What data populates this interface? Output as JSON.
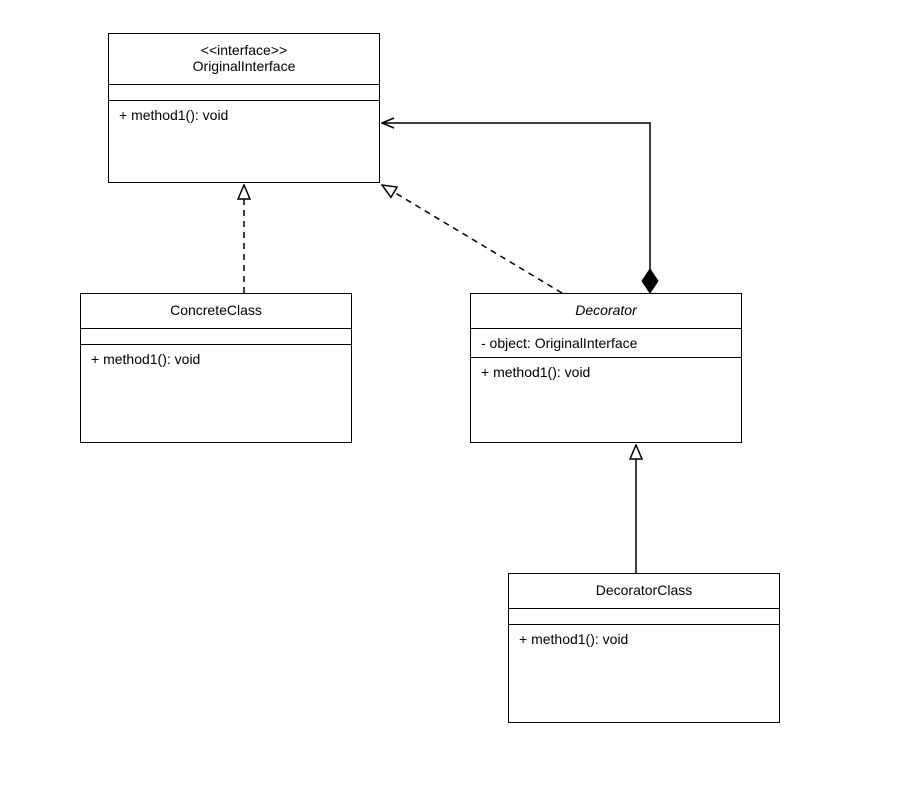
{
  "classes": {
    "originalInterface": {
      "stereotype": "<<interface>>",
      "name": "OriginalInterface",
      "attrs": "",
      "ops": "+ method1(): void"
    },
    "concreteClass": {
      "name": "ConcreteClass",
      "attrs": "",
      "ops": "+ method1(): void"
    },
    "decorator": {
      "name": "Decorator",
      "attrs": "- object: OriginalInterface",
      "ops": "+ method1(): void"
    },
    "decoratorClass": {
      "name": "DecoratorClass",
      "attrs": "",
      "ops": "+ method1(): void"
    }
  },
  "chart_data": {
    "type": "uml-class-diagram",
    "classes": [
      {
        "id": "OriginalInterface",
        "stereotype": "interface",
        "methods": [
          "+ method1(): void"
        ]
      },
      {
        "id": "ConcreteClass",
        "methods": [
          "+ method1(): void"
        ]
      },
      {
        "id": "Decorator",
        "abstract": true,
        "attributes": [
          "- object: OriginalInterface"
        ],
        "methods": [
          "+ method1(): void"
        ]
      },
      {
        "id": "DecoratorClass",
        "methods": [
          "+ method1(): void"
        ]
      }
    ],
    "relationships": [
      {
        "from": "ConcreteClass",
        "to": "OriginalInterface",
        "type": "realization"
      },
      {
        "from": "Decorator",
        "to": "OriginalInterface",
        "type": "realization"
      },
      {
        "from": "Decorator",
        "to": "OriginalInterface",
        "type": "composition"
      },
      {
        "from": "DecoratorClass",
        "to": "Decorator",
        "type": "generalization"
      }
    ]
  }
}
